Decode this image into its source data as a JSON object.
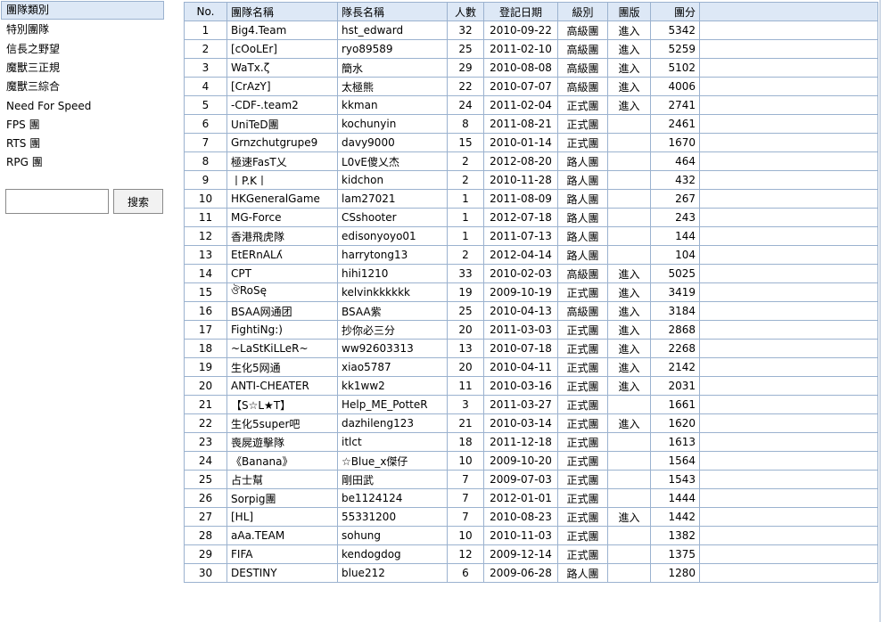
{
  "sidebar": {
    "header": "團隊類別",
    "items": [
      "特別團隊",
      "信長之野望",
      "魔獸三正規",
      "魔獸三綜合",
      "Need For Speed",
      "FPS 團",
      "RTS 團",
      "RPG 團"
    ],
    "search_placeholder": "",
    "search_button": "搜索"
  },
  "table": {
    "headers": [
      "No.",
      "團隊名稱",
      "隊長名稱",
      "人數",
      "登記日期",
      "級別",
      "團版",
      "團分"
    ],
    "rows": [
      [
        "1",
        "Big4.Team",
        "hst_edward",
        "32",
        "2010-09-22",
        "高級團",
        "進入",
        "5342"
      ],
      [
        "2",
        "[cOoLEr]",
        "ryo89589",
        "25",
        "2011-02-10",
        "高級團",
        "進入",
        "5259"
      ],
      [
        "3",
        "WaTx.ζ",
        "簡水",
        "29",
        "2010-08-08",
        "高級團",
        "進入",
        "5102"
      ],
      [
        "4",
        "[CrAzY]",
        "太極熊",
        "22",
        "2010-07-07",
        "高級團",
        "進入",
        "4006"
      ],
      [
        "5",
        "-CDF-.team2",
        "kkman",
        "24",
        "2011-02-04",
        "正式團",
        "進入",
        "2741"
      ],
      [
        "6",
        "UniTeD團",
        "kochunyin",
        "8",
        "2011-08-21",
        "正式團",
        "",
        "2461"
      ],
      [
        "7",
        "Grnzchutgrupe9",
        "davy9000",
        "15",
        "2010-01-14",
        "正式團",
        "",
        "1670"
      ],
      [
        "8",
        "極速FasT乂",
        "L0vE傻乂杰",
        "2",
        "2012-08-20",
        "路人團",
        "",
        "464"
      ],
      [
        "9",
        "丨P.K丨",
        "kidchon",
        "2",
        "2010-11-28",
        "路人團",
        "",
        "432"
      ],
      [
        "10",
        "HKGeneralGame",
        "lam27021",
        "1",
        "2011-08-09",
        "路人團",
        "",
        "267"
      ],
      [
        "11",
        "MG-Force",
        "CSshooter",
        "1",
        "2012-07-18",
        "路人團",
        "",
        "243"
      ],
      [
        "12",
        "香港飛虎隊",
        "edisonyoyo01",
        "1",
        "2011-07-13",
        "路人團",
        "",
        "144"
      ],
      [
        "13",
        "EtERnALʎ",
        "harrytong13",
        "2",
        "2012-04-14",
        "路人團",
        "",
        "104"
      ],
      [
        "14",
        "CPT",
        "hihi1210",
        "33",
        "2010-02-03",
        "高級團",
        "進入",
        "5025"
      ],
      [
        "15",
        "ঔRoSę",
        "kelvinkkkkkk",
        "19",
        "2009-10-19",
        "正式團",
        "進入",
        "3419"
      ],
      [
        "16",
        "BSAA网通团",
        "BSAA紫",
        "25",
        "2010-04-13",
        "高級團",
        "進入",
        "3184"
      ],
      [
        "17",
        "FightiNg:)",
        "抄你必三分",
        "20",
        "2011-03-03",
        "正式團",
        "進入",
        "2868"
      ],
      [
        "18",
        "~LaStKiLLeR~",
        "ww92603313",
        "13",
        "2010-07-18",
        "正式團",
        "進入",
        "2268"
      ],
      [
        "19",
        "生化5网通",
        "xiao5787",
        "20",
        "2010-04-11",
        "正式團",
        "進入",
        "2142"
      ],
      [
        "20",
        "ANTI-CHEATER",
        "kk1ww2",
        "11",
        "2010-03-16",
        "正式團",
        "進入",
        "2031"
      ],
      [
        "21",
        "【S☆L★T】",
        "Help_ME_PotteR",
        "3",
        "2011-03-27",
        "正式團",
        "",
        "1661"
      ],
      [
        "22",
        "生化5super吧",
        "dazhileng123",
        "21",
        "2010-03-14",
        "正式團",
        "進入",
        "1620"
      ],
      [
        "23",
        "喪屍遊擊隊",
        "itlct",
        "18",
        "2011-12-18",
        "正式團",
        "",
        "1613"
      ],
      [
        "24",
        "《Banana》",
        "☆Blue_x傑仔",
        "10",
        "2009-10-20",
        "正式團",
        "",
        "1564"
      ],
      [
        "25",
        "占士幫",
        "剛田武",
        "7",
        "2009-07-03",
        "正式團",
        "",
        "1543"
      ],
      [
        "26",
        "Sorpig團",
        "be1124124",
        "7",
        "2012-01-01",
        "正式團",
        "",
        "1444"
      ],
      [
        "27",
        "[HL]",
        "55331200",
        "7",
        "2010-08-23",
        "正式團",
        "進入",
        "1442"
      ],
      [
        "28",
        "aAa.TEAM",
        "sohung",
        "10",
        "2010-11-03",
        "正式團",
        "",
        "1382"
      ],
      [
        "29",
        "FIFA",
        "kendogdog",
        "12",
        "2009-12-14",
        "正式團",
        "",
        "1375"
      ],
      [
        "30",
        "DESTINY",
        "blue212",
        "6",
        "2009-06-28",
        "路人團",
        "",
        "1280"
      ]
    ]
  },
  "colors": {
    "header_bg": "#dde8f6",
    "border": "#9bb2cf"
  }
}
